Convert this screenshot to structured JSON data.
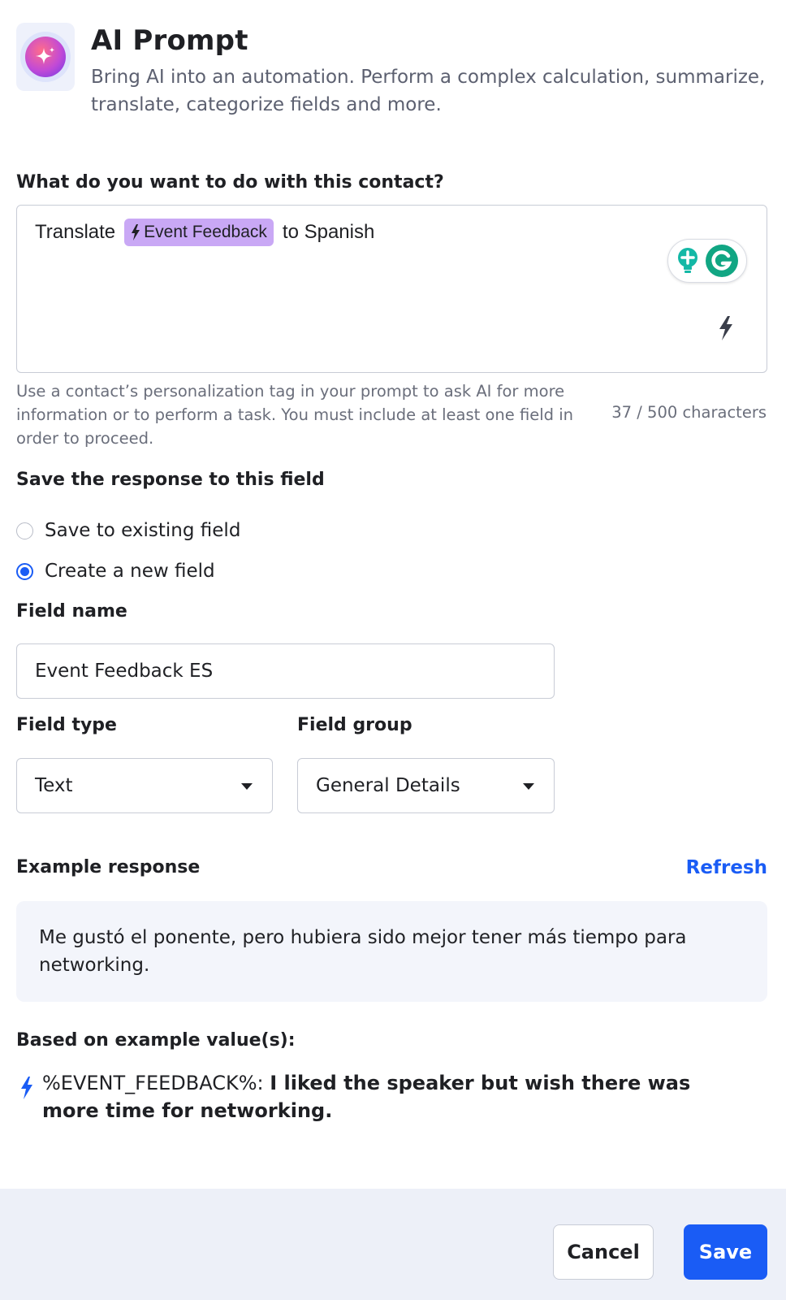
{
  "header": {
    "icon": "sparkle-icon",
    "title": "AI Prompt",
    "subtitle": "Bring AI into an automation. Perform a complex calculation, summarize, translate, categorize fields and more."
  },
  "prompt": {
    "label": "What do you want to do with this contact?",
    "text_before": "Translate",
    "tag_label": "Event Feedback",
    "text_after": "to Spanish",
    "helper": "Use a contact’s personalization tag in your prompt to ask AI for more information or to perform a task. You must include at least one field in order to proceed.",
    "counter": "37 / 500 characters"
  },
  "save_response": {
    "label": "Save the response to this field",
    "options": [
      "Save to existing field",
      "Create a new field"
    ],
    "selected": "Create a new field"
  },
  "field_name": {
    "label": "Field name",
    "value": "Event Feedback ES"
  },
  "field_type": {
    "label": "Field type",
    "value": "Text"
  },
  "field_group": {
    "label": "Field group",
    "value": "General Details"
  },
  "example": {
    "label": "Example response",
    "refresh_label": "Refresh",
    "text": "Me gustó el ponente, pero hubiera sido mejor tener más tiempo para networking."
  },
  "based_on": {
    "label": "Based on example value(s):",
    "tag": "%EVENT_FEEDBACK%:",
    "value": "I liked the speaker but wish there was more time for networking."
  },
  "footer": {
    "cancel_label": "Cancel",
    "save_label": "Save"
  },
  "colors": {
    "accent": "#1a5cf5",
    "tag_bg": "#c9a8f5",
    "example_bg": "#f3f5fb",
    "footer_bg": "#edf0f8"
  }
}
